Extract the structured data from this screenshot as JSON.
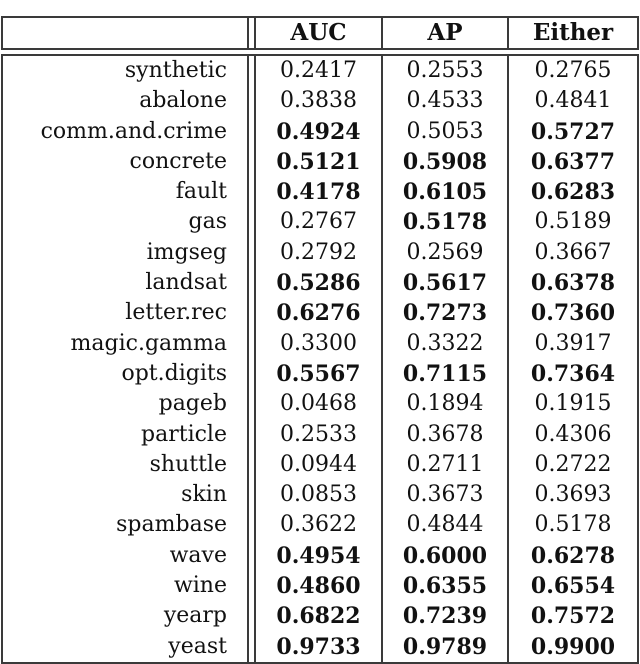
{
  "table": {
    "headers": [
      "",
      "AUC",
      "AP",
      "Either"
    ],
    "rows": [
      {
        "name": "synthetic",
        "auc": "0.2417",
        "ap": "0.2553",
        "either": "0.2765",
        "bold": [
          false,
          false,
          false
        ]
      },
      {
        "name": "abalone",
        "auc": "0.3838",
        "ap": "0.4533",
        "either": "0.4841",
        "bold": [
          false,
          false,
          false
        ]
      },
      {
        "name": "comm.and.crime",
        "auc": "0.4924",
        "ap": "0.5053",
        "either": "0.5727",
        "bold": [
          true,
          false,
          true
        ]
      },
      {
        "name": "concrete",
        "auc": "0.5121",
        "ap": "0.5908",
        "either": "0.6377",
        "bold": [
          true,
          true,
          true
        ]
      },
      {
        "name": "fault",
        "auc": "0.4178",
        "ap": "0.6105",
        "either": "0.6283",
        "bold": [
          true,
          true,
          true
        ]
      },
      {
        "name": "gas",
        "auc": "0.2767",
        "ap": "0.5178",
        "either": "0.5189",
        "bold": [
          false,
          true,
          false
        ]
      },
      {
        "name": "imgseg",
        "auc": "0.2792",
        "ap": "0.2569",
        "either": "0.3667",
        "bold": [
          false,
          false,
          false
        ]
      },
      {
        "name": "landsat",
        "auc": "0.5286",
        "ap": "0.5617",
        "either": "0.6378",
        "bold": [
          true,
          true,
          true
        ]
      },
      {
        "name": "letter.rec",
        "auc": "0.6276",
        "ap": "0.7273",
        "either": "0.7360",
        "bold": [
          true,
          true,
          true
        ]
      },
      {
        "name": "magic.gamma",
        "auc": "0.3300",
        "ap": "0.3322",
        "either": "0.3917",
        "bold": [
          false,
          false,
          false
        ]
      },
      {
        "name": "opt.digits",
        "auc": "0.5567",
        "ap": "0.7115",
        "either": "0.7364",
        "bold": [
          true,
          true,
          true
        ]
      },
      {
        "name": "pageb",
        "auc": "0.0468",
        "ap": "0.1894",
        "either": "0.1915",
        "bold": [
          false,
          false,
          false
        ]
      },
      {
        "name": "particle",
        "auc": "0.2533",
        "ap": "0.3678",
        "either": "0.4306",
        "bold": [
          false,
          false,
          false
        ]
      },
      {
        "name": "shuttle",
        "auc": "0.0944",
        "ap": "0.2711",
        "either": "0.2722",
        "bold": [
          false,
          false,
          false
        ]
      },
      {
        "name": "skin",
        "auc": "0.0853",
        "ap": "0.3673",
        "either": "0.3693",
        "bold": [
          false,
          false,
          false
        ]
      },
      {
        "name": "spambase",
        "auc": "0.3622",
        "ap": "0.4844",
        "either": "0.5178",
        "bold": [
          false,
          false,
          false
        ]
      },
      {
        "name": "wave",
        "auc": "0.4954",
        "ap": "0.6000",
        "either": "0.6278",
        "bold": [
          true,
          true,
          true
        ]
      },
      {
        "name": "wine",
        "auc": "0.4860",
        "ap": "0.6355",
        "either": "0.6554",
        "bold": [
          true,
          true,
          true
        ]
      },
      {
        "name": "yearp",
        "auc": "0.6822",
        "ap": "0.7239",
        "either": "0.7572",
        "bold": [
          true,
          true,
          true
        ]
      },
      {
        "name": "yeast",
        "auc": "0.9733",
        "ap": "0.9789",
        "either": "0.9900",
        "bold": [
          true,
          true,
          true
        ]
      }
    ]
  }
}
